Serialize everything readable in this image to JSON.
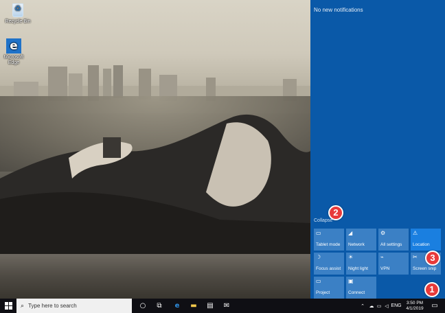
{
  "desktop": {
    "icons": [
      {
        "name": "Recycle Bin",
        "icon": "recycle-bin-icon"
      },
      {
        "name": "Microsoft Edge",
        "icon": "edge-icon"
      }
    ]
  },
  "action_center": {
    "no_notifications": "No new notifications",
    "collapse_label": "Collapse",
    "tiles": [
      {
        "label": "Tablet mode",
        "icon": "tablet-mode-icon",
        "active": false
      },
      {
        "label": "Network",
        "icon": "network-icon",
        "active": false
      },
      {
        "label": "All settings",
        "icon": "settings-icon",
        "active": false
      },
      {
        "label": "Location",
        "icon": "location-icon",
        "active": true
      },
      {
        "label": "Focus assist",
        "icon": "moon-icon",
        "active": false
      },
      {
        "label": "Night light",
        "icon": "sun-icon",
        "active": false
      },
      {
        "label": "VPN",
        "icon": "vpn-icon",
        "active": false
      },
      {
        "label": "Screen snip",
        "icon": "scissors-icon",
        "active": false
      },
      {
        "label": "Project",
        "icon": "project-icon",
        "active": false
      },
      {
        "label": "Connect",
        "icon": "connect-icon",
        "active": false
      }
    ]
  },
  "callouts": [
    "1",
    "2",
    "3"
  ],
  "taskbar": {
    "search_placeholder": "Type here to search",
    "language": "ENG",
    "time": "3:50 PM",
    "date": "4/1/2019"
  },
  "colors": {
    "action_center_bg": "#0a59a8",
    "tile_bg": "#3b80c5",
    "tile_active_bg": "#1a7fe0",
    "callout": "#e83a3a",
    "taskbar_bg": "#0f0f14"
  }
}
